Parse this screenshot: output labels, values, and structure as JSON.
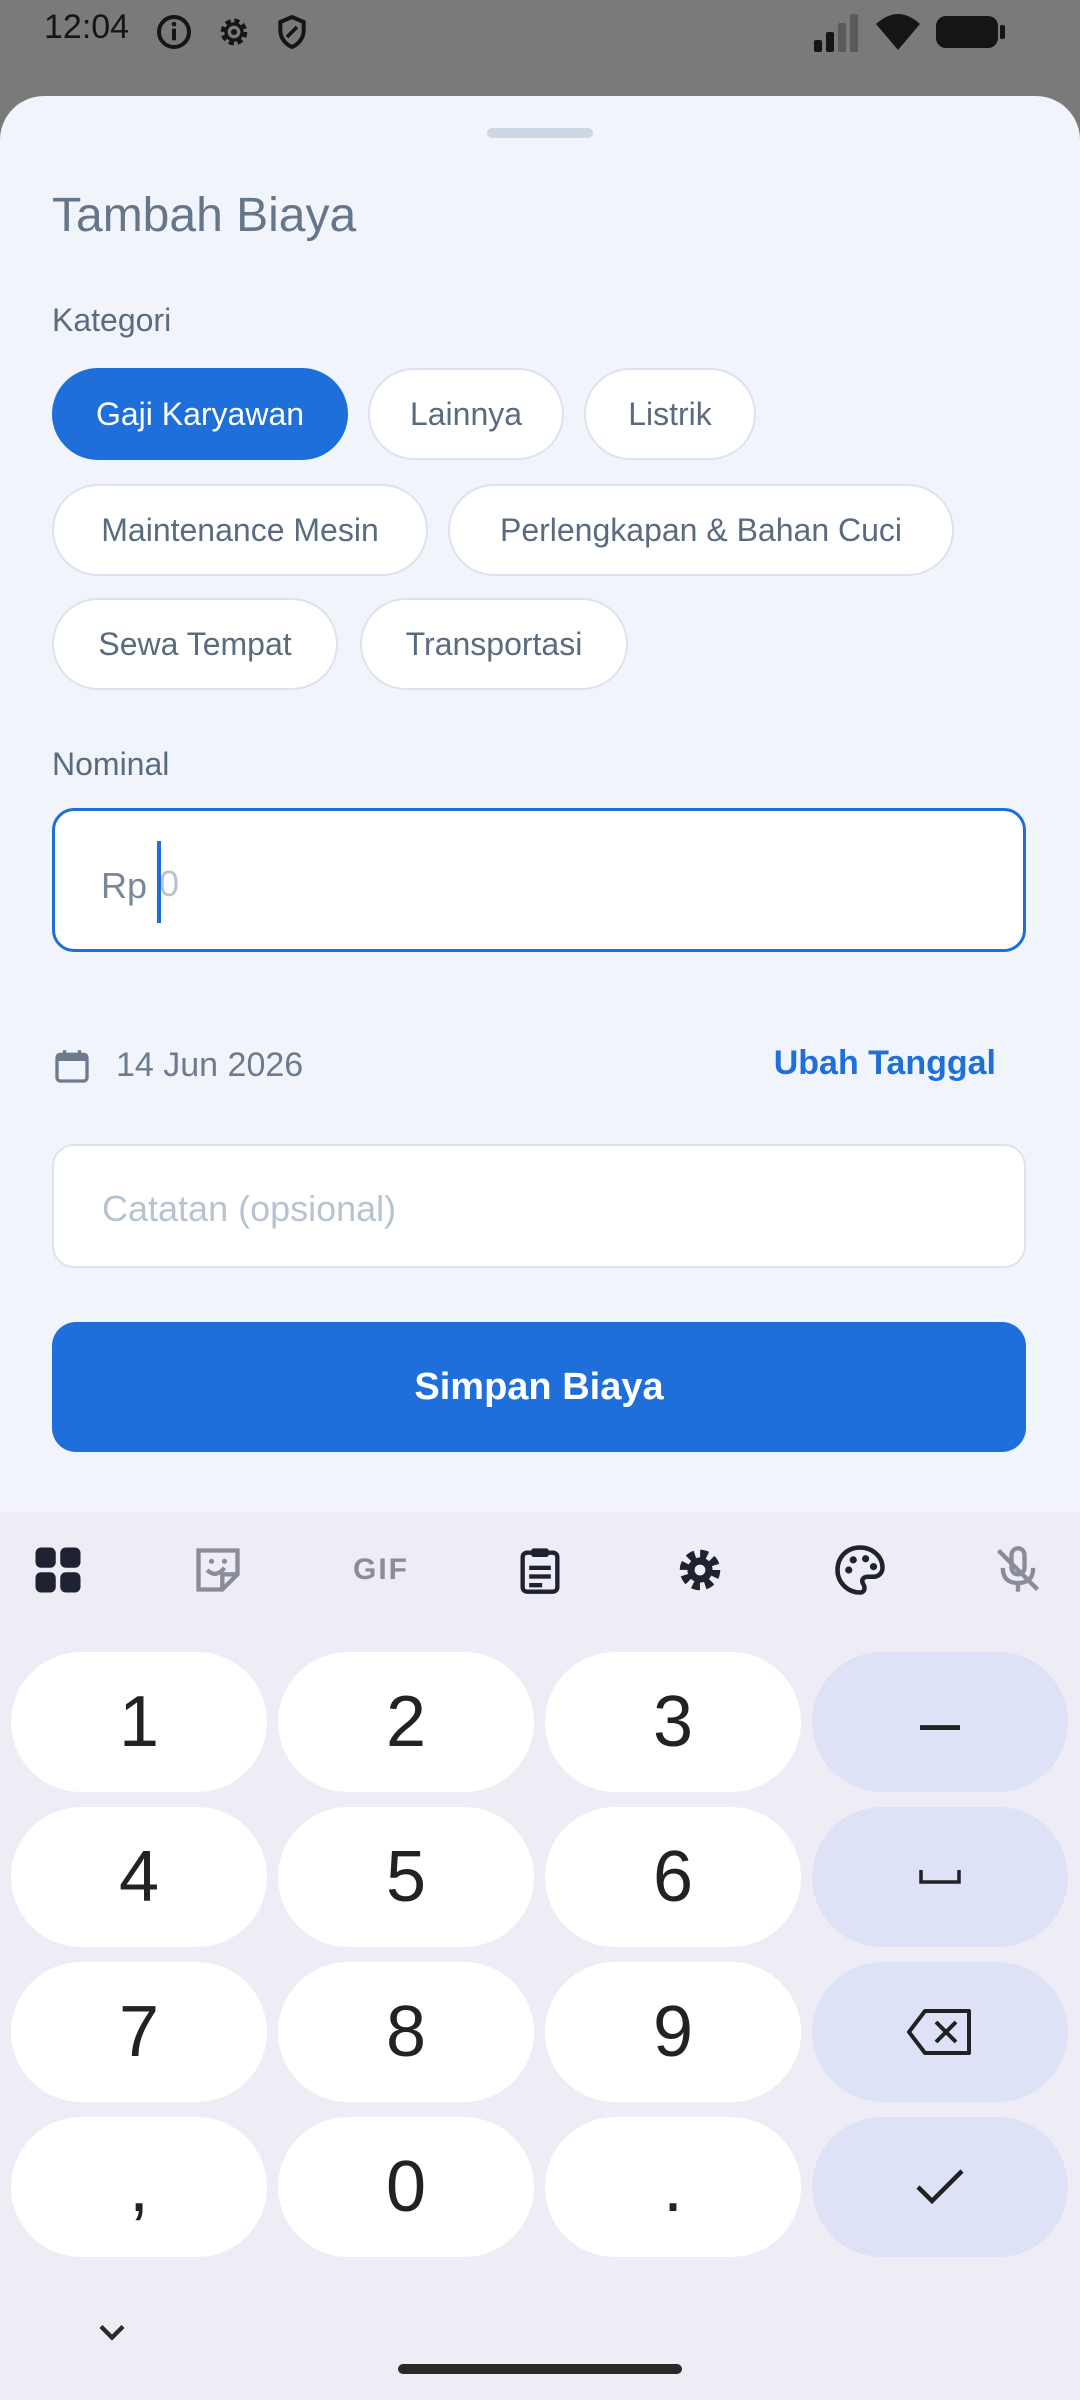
{
  "status_bar": {
    "time": "12:04"
  },
  "sheet": {
    "title": "Tambah Biaya",
    "category_label": "Kategori",
    "categories": [
      {
        "label": "Gaji Karyawan",
        "selected": true
      },
      {
        "label": "Lainnya",
        "selected": false
      },
      {
        "label": "Listrik",
        "selected": false
      },
      {
        "label": "Maintenance Mesin",
        "selected": false
      },
      {
        "label": "Perlengkapan & Bahan Cuci",
        "selected": false
      },
      {
        "label": "Sewa Tempat",
        "selected": false
      },
      {
        "label": "Transportasi",
        "selected": false
      }
    ],
    "amount_label": "Nominal",
    "amount_prefix": "Rp",
    "amount_placeholder": "0",
    "date_value": "14 Jun 2026",
    "change_date_label": "Ubah Tanggal",
    "note_placeholder": "Catatan (opsional)",
    "save_label": "Simpan Biaya"
  },
  "keyboard": {
    "toolbar": [
      "apps-grid-icon",
      "sticker-icon",
      "gif-icon",
      "clipboard-icon",
      "settings-gear-icon",
      "palette-icon",
      "mic-off-icon"
    ],
    "gif_label": "GIF",
    "keys": {
      "k1": "1",
      "k2": "2",
      "k3": "3",
      "dash": "–",
      "k4": "4",
      "k5": "5",
      "k6": "6",
      "k7": "7",
      "k8": "8",
      "k9": "9",
      "comma": ",",
      "k0": "0",
      "period": "."
    },
    "function_keys": [
      "space-icon",
      "backspace-icon",
      "enter-check-icon"
    ]
  },
  "colors": {
    "accent": "#1e6fd9",
    "sheet_bg": "#f1f5fb",
    "keyboard_bg": "#eeedf6",
    "function_key_bg": "#dde2f6"
  }
}
